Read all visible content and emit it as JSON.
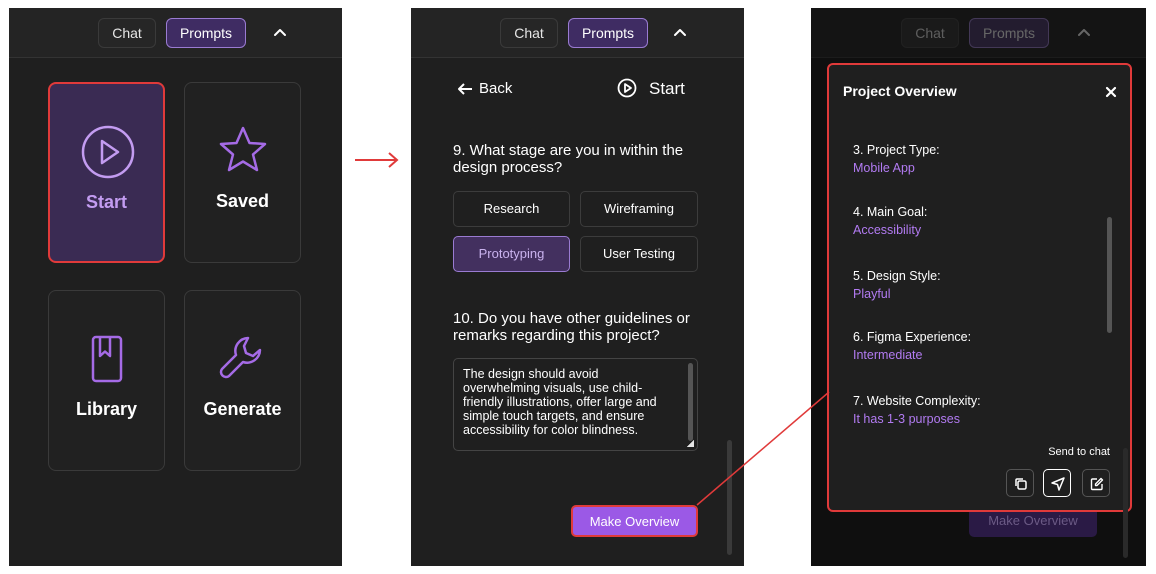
{
  "tabs": {
    "chat": "Chat",
    "prompts": "Prompts"
  },
  "home": {
    "tiles": [
      {
        "label": "Start",
        "icon": "play-circle-icon"
      },
      {
        "label": "Saved",
        "icon": "star-icon"
      },
      {
        "label": "Library",
        "icon": "bookmark-book-icon"
      },
      {
        "label": "Generate",
        "icon": "wrench-icon"
      }
    ]
  },
  "questions": {
    "back_label": "Back",
    "start_label": "Start",
    "q9": "9. What stage are you in within the design process?",
    "options": [
      "Research",
      "Wireframing",
      "Prototyping",
      "User Testing"
    ],
    "selected_option": "Prototyping",
    "q10": "10. Do you have other guidelines or remarks regarding this project?",
    "answer": "The design should avoid overwhelming visuals, use child-friendly illustrations, offer large and simple touch targets, and ensure accessibility for color blindness.",
    "make_overview": "Make Overview"
  },
  "overview": {
    "title": "Project Overview",
    "items": [
      {
        "label": "3. Project Type:",
        "value": "Mobile App"
      },
      {
        "label": "4. Main Goal:",
        "value": "Accessibility"
      },
      {
        "label": "5. Design Style:",
        "value": "Playful"
      },
      {
        "label": "6. Figma Experience:",
        "value": "Intermediate"
      },
      {
        "label": "7. Website Complexity:",
        "value": "It has 1-3 purposes"
      }
    ],
    "send_to_chat": "Send to chat",
    "action_icons": [
      "copy-icon",
      "send-icon",
      "edit-icon"
    ]
  },
  "colors": {
    "accent": "#9b59e6",
    "accent_text": "#b27bf2",
    "highlight": "#e03a3a",
    "panel_bg": "#1f1f1f"
  }
}
